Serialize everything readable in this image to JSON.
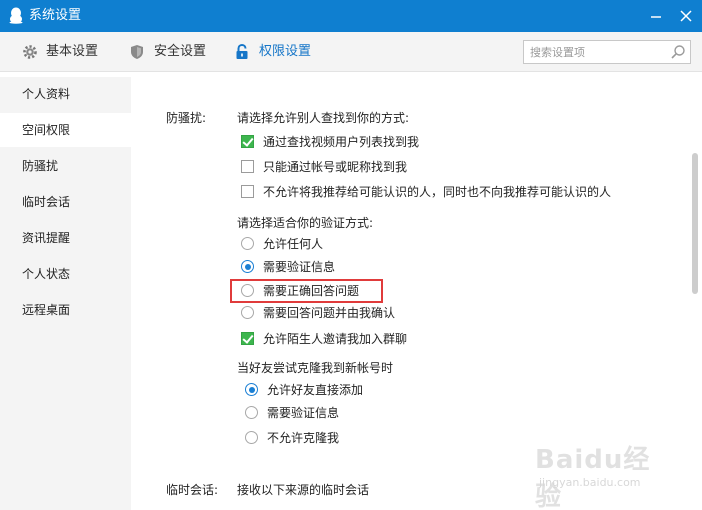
{
  "window": {
    "title": "系统设置"
  },
  "toolbar": {
    "items": [
      {
        "label": "基本设置",
        "icon": "gear-icon"
      },
      {
        "label": "安全设置",
        "icon": "shield-icon"
      },
      {
        "label": "权限设置",
        "icon": "lock-icon",
        "active": true
      }
    ],
    "search_placeholder": "搜索设置项"
  },
  "sidebar": {
    "items": [
      {
        "label": "个人资料"
      },
      {
        "label": "空间权限",
        "active": true
      },
      {
        "label": "防骚扰"
      },
      {
        "label": "临时会话"
      },
      {
        "label": "资讯提醒"
      },
      {
        "label": "个人状态"
      },
      {
        "label": "远程桌面"
      }
    ]
  },
  "anti_harass": {
    "label": "防骚扰:",
    "find_prompt": "请选择允许别人查找到你的方式:",
    "find_options": [
      {
        "label": "通过查找视频用户列表找到我",
        "checked": true
      },
      {
        "label": "只能通过帐号或昵称找到我",
        "checked": false
      },
      {
        "label": "不允许将我推荐给可能认识的人，同时也不向我推荐可能认识的人",
        "checked": false
      }
    ],
    "verify_prompt": "请选择适合你的验证方式:",
    "verify_options": [
      {
        "label": "允许任何人",
        "selected": false
      },
      {
        "label": "需要验证信息",
        "selected": true
      },
      {
        "label": "需要正确回答问题",
        "selected": false,
        "highlighted": true
      },
      {
        "label": "需要回答问题并由我确认",
        "selected": false
      }
    ],
    "group_invite": {
      "label": "允许陌生人邀请我加入群聊",
      "checked": true
    },
    "clone_prompt": "当好友尝试克隆我到新帐号时",
    "clone_options": [
      {
        "label": "允许好友直接添加",
        "selected": true
      },
      {
        "label": "需要验证信息",
        "selected": false
      },
      {
        "label": "不允许克隆我",
        "selected": false
      }
    ]
  },
  "temp_session": {
    "label": "临时会话:",
    "prompt": "接收以下来源的临时会话"
  },
  "colors": {
    "titlebar": "#0f7fd0",
    "accent": "#1676c8",
    "check_green": "#3db64e",
    "highlight_red": "#e03b3b"
  },
  "watermark": {
    "text": "Baidu经验",
    "sub": "jingyan.baidu.com"
  }
}
